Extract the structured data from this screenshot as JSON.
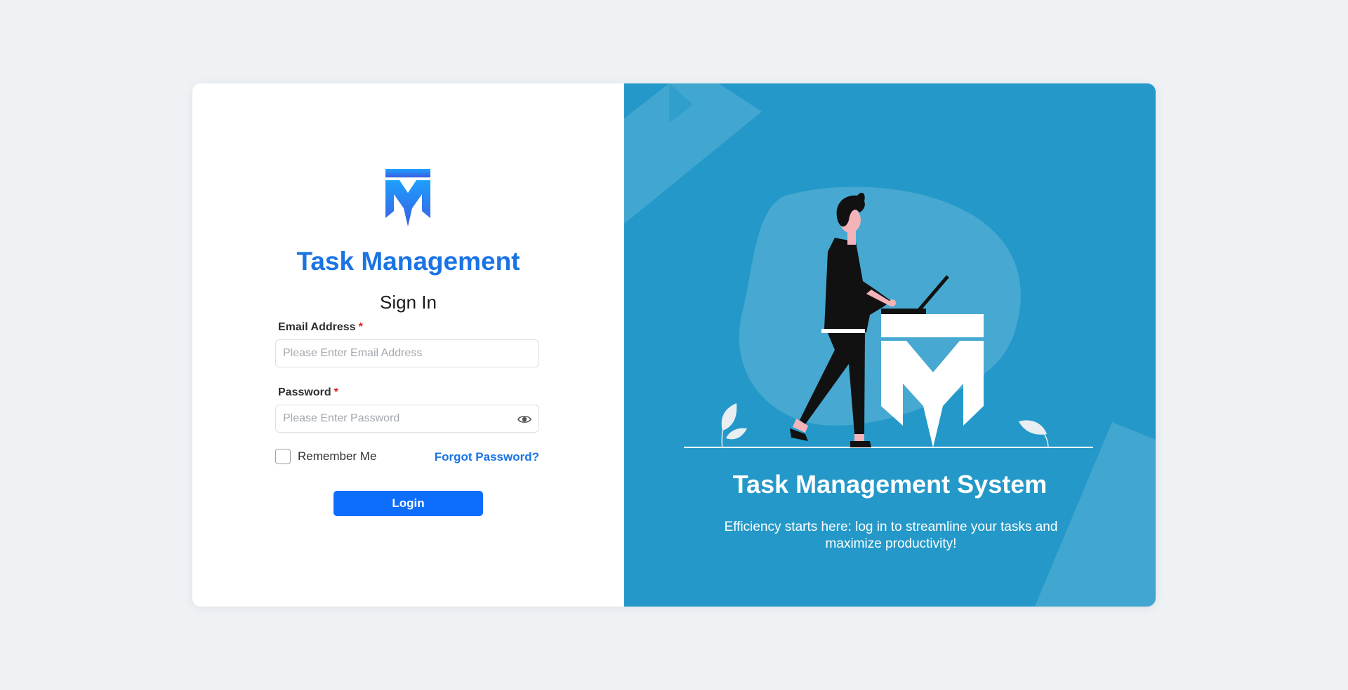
{
  "brand": {
    "name": "Task Management"
  },
  "form": {
    "heading": "Sign In",
    "email": {
      "label": "Email Address",
      "required_mark": "*",
      "placeholder": "Please Enter Email Address",
      "value": ""
    },
    "password": {
      "label": "Password",
      "required_mark": "*",
      "placeholder": "Please Enter Password",
      "value": "",
      "toggle_icon": "eye-icon"
    },
    "remember_label": "Remember Me",
    "remember_checked": false,
    "forgot_label": "Forgot Password?",
    "login_label": "Login"
  },
  "hero": {
    "title": "Task Management System",
    "description": "Efficiency starts here: log in to streamline your tasks and maximize productivity!"
  },
  "colors": {
    "brand_blue": "#1b74e4",
    "button_blue": "#0d6efd",
    "panel_blue": "#2499c9",
    "required_red": "#e02424",
    "page_bg": "#eef2f5"
  }
}
